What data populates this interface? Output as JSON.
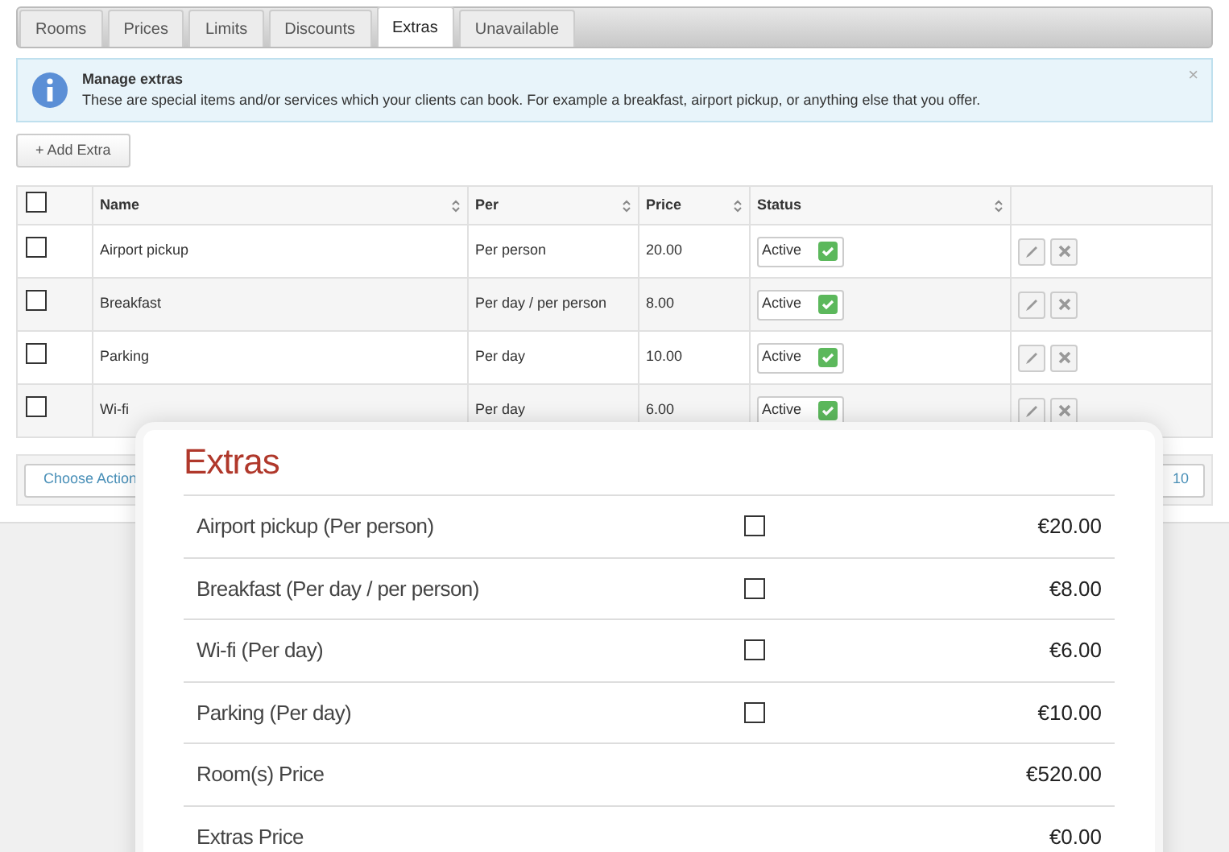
{
  "tabs": [
    {
      "label": "Rooms",
      "selected": false
    },
    {
      "label": "Prices",
      "selected": false
    },
    {
      "label": "Limits",
      "selected": false
    },
    {
      "label": "Discounts",
      "selected": false
    },
    {
      "label": "Extras",
      "selected": true
    },
    {
      "label": "Unavailable",
      "selected": false
    }
  ],
  "notice": {
    "title": "Manage extras",
    "text": "These are special items and/or services which your clients can book. For example a breakfast, airport pickup, or anything else that you offer.",
    "close": "×"
  },
  "add_button": "+ Add Extra",
  "table": {
    "select_all": {
      "checked": false
    },
    "columns": [
      "Name",
      "Per",
      "Price",
      "Status"
    ],
    "rows": [
      {
        "checked": false,
        "name": "Airport pickup",
        "per": "Per person",
        "price": "20.00",
        "status": "Active",
        "enabled": true
      },
      {
        "checked": false,
        "name": "Breakfast",
        "per": "Per day / per person",
        "price": "8.00",
        "status": "Active",
        "enabled": true
      },
      {
        "checked": false,
        "name": "Parking",
        "per": "Per day",
        "price": "10.00",
        "status": "Active",
        "enabled": true
      },
      {
        "checked": false,
        "name": "Wi-fi",
        "per": "Per day",
        "price": "6.00",
        "status": "Active",
        "enabled": true
      }
    ]
  },
  "footer": {
    "action": "Choose Action",
    "page_size": "10"
  },
  "extras_card": {
    "title": "Extras",
    "items": [
      {
        "label": "Airport pickup (Per person)",
        "checked": false,
        "price": "€20.00"
      },
      {
        "label": "Breakfast (Per day / per person)",
        "checked": false,
        "price": "€8.00"
      },
      {
        "label": "Wi-fi (Per day)",
        "checked": false,
        "price": "€6.00"
      },
      {
        "label": "Parking (Per day)",
        "checked": false,
        "price": "€10.00"
      }
    ],
    "totals": [
      {
        "label": "Room(s) Price",
        "price": "€520.00"
      },
      {
        "label": "Extras Price",
        "price": "€0.00"
      }
    ]
  }
}
